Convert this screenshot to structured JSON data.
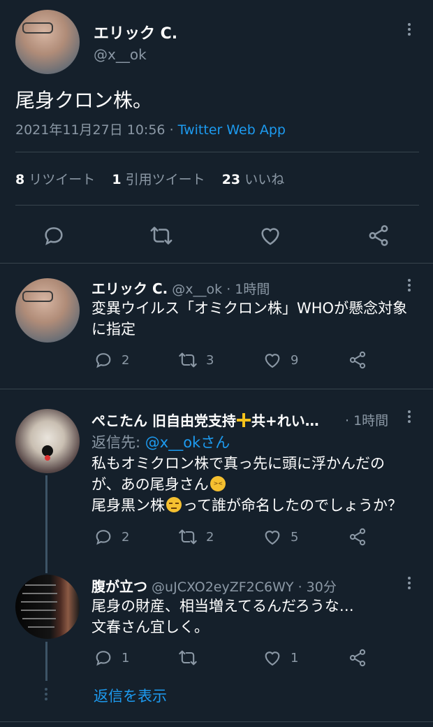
{
  "main_tweet": {
    "author_name": "エリック C.",
    "handle": "@x__ok",
    "text": "尾身クロン株。",
    "timestamp": "2021年11月27日 10:56",
    "separator": "·",
    "source": "Twitter Web App",
    "stats": {
      "retweets_count": "8",
      "retweets_label": "リツイート",
      "quotes_count": "1",
      "quotes_label": "引用ツイート",
      "likes_count": "23",
      "likes_label": "いいね"
    }
  },
  "replies": [
    {
      "author_name": "エリック C.",
      "handle": "@x__ok",
      "time": "· 1時間",
      "text_lines": [
        "変異ウイルス「オミクロン株」WHOが懸念対象",
        "に指定"
      ],
      "reply_count": "2",
      "retweet_count": "3",
      "like_count": "9"
    },
    {
      "author_name": "ぺこたん 旧自由党支持",
      "name_suffix": "共+れい…",
      "emoji_icon": "plus-emoji",
      "time": "· 1時間",
      "reply_to_label": "返信先:",
      "reply_to_handle": "@x__okさん",
      "text_lines": [
        "私もオミクロン株で真っ先に頭に浮かんだの",
        "が、あの尾身さん",
        "尾身黒ン株",
        "って誰が命名したのでしょうか？"
      ],
      "reply_count": "2",
      "retweet_count": "2",
      "like_count": "5"
    },
    {
      "author_name": "腹が立つ",
      "handle": "@uJCXO2eyZF2C6WY",
      "time": "· 30分",
      "text_lines": [
        "尾身の財産、相当増えてるんだろうな…",
        "文春さん宜しく。"
      ],
      "reply_count": "1",
      "retweet_count": "",
      "like_count": "1"
    }
  ],
  "show_replies_label": "返信を表示",
  "colors": {
    "background": "#15202b",
    "accent": "#1d9bf0",
    "muted": "#8b98a5",
    "divider": "#38444d"
  }
}
